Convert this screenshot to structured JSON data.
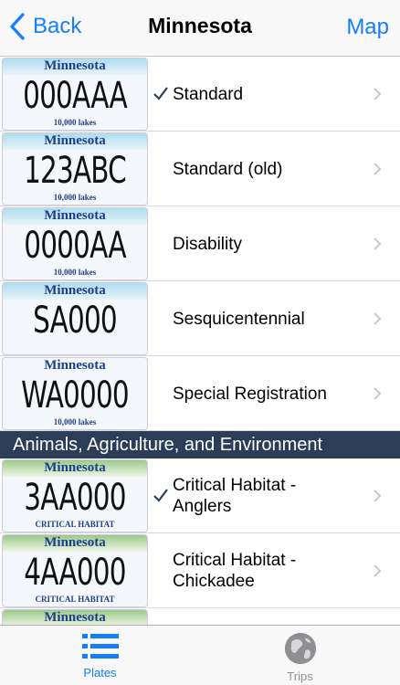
{
  "nav": {
    "back_label": "Back",
    "title": "Minnesota",
    "right_label": "Map"
  },
  "rows": [
    {
      "plate": {
        "state": "Minnesota",
        "number": "000AAA",
        "sub": "10,000 lakes",
        "band": "blue"
      },
      "checked": true,
      "label": "Standard"
    },
    {
      "plate": {
        "state": "Minnesota",
        "number": "123ABC",
        "sub": "10,000 lakes",
        "band": "blue"
      },
      "checked": false,
      "label": "Standard (old)"
    },
    {
      "plate": {
        "state": "Minnesota",
        "number": "0000AA",
        "sub": "10,000 lakes",
        "band": "blue"
      },
      "checked": false,
      "label": "Disability"
    },
    {
      "plate": {
        "state": "Minnesota",
        "number": "SA000",
        "sub": "",
        "band": "blue"
      },
      "checked": false,
      "label": "Sesquicentennial"
    },
    {
      "plate": {
        "state": "Minnesota",
        "number": "WA0000",
        "sub": "10,000 lakes",
        "band": "none"
      },
      "checked": false,
      "label": "Special Registration"
    }
  ],
  "section": {
    "title": "Animals, Agriculture, and Environment"
  },
  "rows2": [
    {
      "plate": {
        "state": "Minnesota",
        "number": "3AA000",
        "sub": "CRITICAL HABITAT",
        "band": "green"
      },
      "checked": true,
      "label": "Critical Habitat - Anglers"
    },
    {
      "plate": {
        "state": "Minnesota",
        "number": "4AA000",
        "sub": "CRITICAL HABITAT",
        "band": "green"
      },
      "checked": false,
      "label": "Critical Habitat - Chickadee"
    },
    {
      "plate": {
        "state": "Minnesota",
        "number": "",
        "sub": "",
        "band": "green"
      },
      "checked": false,
      "label": ""
    }
  ],
  "tabs": [
    {
      "label": "Plates",
      "icon": "list-icon",
      "active": true
    },
    {
      "label": "Trips",
      "icon": "globe-icon",
      "active": false
    }
  ],
  "colors": {
    "accent": "#157efb",
    "section_bg": "#2c3e57"
  }
}
